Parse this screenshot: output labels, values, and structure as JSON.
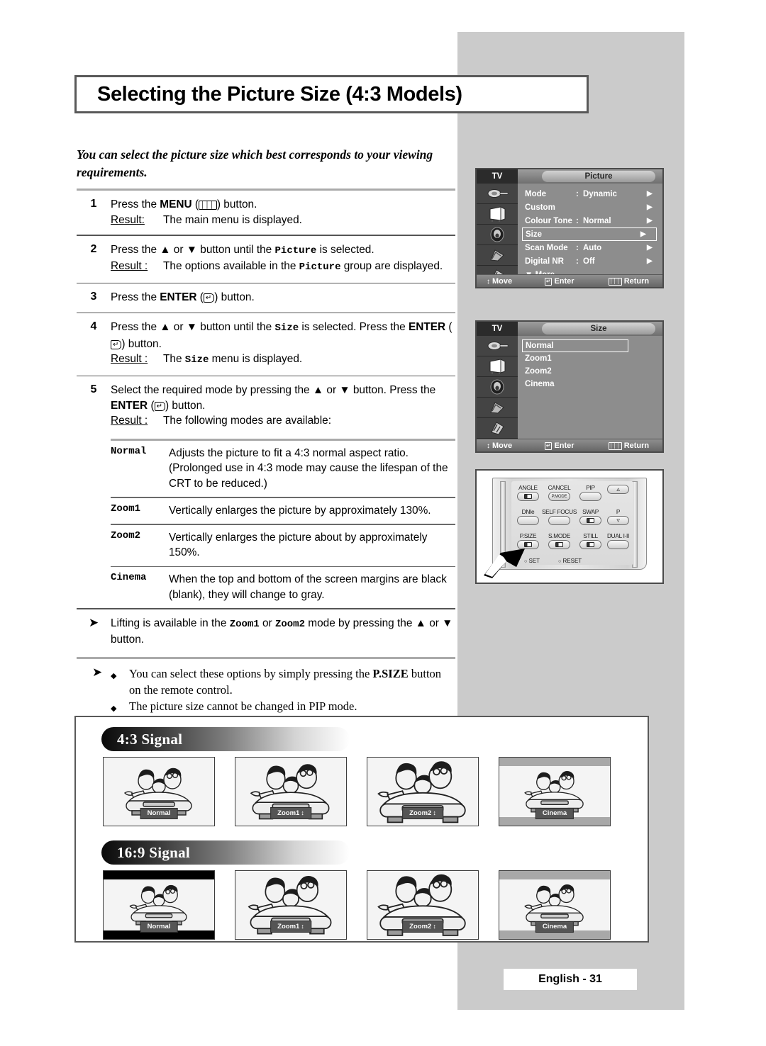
{
  "page": {
    "title": "Selecting the Picture Size (4:3 Models)",
    "intro": "You can select the picture size which best corresponds to your viewing requirements.",
    "footer": "English - 31"
  },
  "steps": [
    {
      "num": "1",
      "line1_a": "Press the ",
      "line1_bold": "MENU",
      "line1_b": " (",
      "key": "menu-icon",
      "line1_c": ") button.",
      "result_label": "Result:",
      "result_text": "The main menu is displayed."
    },
    {
      "num": "2",
      "line1_a": "Press the ▲ or ▼ button until the ",
      "mono1": "Picture",
      "line1_b": " is selected.",
      "result_label": "Result :",
      "result_a": "The options available in the ",
      "result_mono": "Picture",
      "result_b": " group are displayed."
    },
    {
      "num": "3",
      "line1_a": "Press the ",
      "line1_bold": "ENTER",
      "line1_b": " (",
      "key": "enter-icon",
      "line1_c": ") button."
    },
    {
      "num": "4",
      "line1_a": "Press the ▲ or ▼ button until the ",
      "mono1": "Size",
      "line1_b": " is selected. Press the ",
      "line2_bold": "ENTER",
      "line2_b": " (",
      "line2_c": ") button.",
      "result_label": "Result :",
      "result_a": "The ",
      "result_mono": "Size",
      "result_b": " menu is displayed."
    },
    {
      "num": "5",
      "line1_a": "Select the required  mode by pressing the ▲ or ▼ button. Press the ",
      "line2_bold": "ENTER",
      "line2_b": " (",
      "line2_c": ") button.",
      "result_label": "Result :",
      "result_text": "The following modes are available:"
    }
  ],
  "modes": [
    {
      "name": "Normal",
      "desc": "Adjusts the picture to fit a 4:3 normal aspect ratio. (Prolonged use in 4:3 mode may cause the lifespan of the CRT to be reduced.)"
    },
    {
      "name": "Zoom1",
      "desc": "Vertically enlarges the picture by approximately 130%."
    },
    {
      "name": "Zoom2",
      "desc": "Vertically enlarges the picture about by approximately 150%."
    },
    {
      "name": "Cinema",
      "desc": "When the top and bottom of the screen margins are black (blank), they will change to gray."
    }
  ],
  "notes": {
    "note1_a": "Lifting is available in the ",
    "note1_mono1": "Zoom1",
    "note1_b": " or ",
    "note1_mono2": "Zoom2",
    "note1_c": " mode by pressing the ▲ or ▼ button.",
    "note2_a": "You can select these options by simply pressing the ",
    "note2_bold": "P.SIZE",
    "note2_b": " button on the remote control.",
    "note3": "The picture size cannot be changed in PIP mode."
  },
  "osd_picture": {
    "tv_label": "TV",
    "tab_label": "Picture",
    "rows": [
      {
        "label": "Mode",
        "colon": ":",
        "value": "Dynamic",
        "arrow": "▶",
        "selected": false
      },
      {
        "label": "Custom",
        "colon": "",
        "value": "",
        "arrow": "▶",
        "selected": false
      },
      {
        "label": "Colour Tone",
        "colon": ":",
        "value": "Normal",
        "arrow": "▶",
        "selected": false
      },
      {
        "label": "Size",
        "colon": "",
        "value": "",
        "arrow": "▶",
        "selected": true
      },
      {
        "label": "Scan Mode",
        "colon": ":",
        "value": "Auto",
        "arrow": "▶",
        "selected": false
      },
      {
        "label": "Digital NR",
        "colon": ":",
        "value": "Off",
        "arrow": "▶",
        "selected": false
      }
    ],
    "more": "▼ More",
    "footer": {
      "move": "Move",
      "enter": "Enter",
      "return": "Return"
    }
  },
  "osd_size": {
    "tv_label": "TV",
    "tab_label": "Size",
    "options": [
      {
        "label": "Normal",
        "selected": true
      },
      {
        "label": "Zoom1",
        "selected": false
      },
      {
        "label": "Zoom2",
        "selected": false
      },
      {
        "label": "Cinema",
        "selected": false
      }
    ],
    "footer": {
      "move": "Move",
      "enter": "Enter",
      "return": "Return"
    }
  },
  "remote": {
    "buttons": [
      {
        "label": "ANGLE",
        "glyph": "icon"
      },
      {
        "label": "CANCEL",
        "glyph": "P.MODE"
      },
      {
        "label": "PIP",
        "glyph": ""
      },
      {
        "label": "",
        "glyph": "⌃"
      },
      {
        "label": "DNIe",
        "glyph": ""
      },
      {
        "label": "SELF FOCUS",
        "glyph": ""
      },
      {
        "label": "SWAP",
        "glyph": "icon"
      },
      {
        "label": "P",
        "glyph": "⌄"
      },
      {
        "label": "P.SIZE",
        "glyph": "icon"
      },
      {
        "label": "S.MODE",
        "glyph": "icon"
      },
      {
        "label": "STILL",
        "glyph": "icon"
      },
      {
        "label": "DUAL I-II",
        "glyph": ""
      }
    ],
    "set_label": "SET",
    "reset_label": "RESET"
  },
  "signal_sections": [
    {
      "banner": "4:3 Signal",
      "shots": [
        {
          "label": "Normal",
          "stepper": false,
          "bars": "none"
        },
        {
          "label": "Zoom1",
          "stepper": true,
          "bars": "none"
        },
        {
          "label": "Zoom2",
          "stepper": true,
          "bars": "none"
        },
        {
          "label": "Cinema",
          "stepper": false,
          "bars": "gray"
        }
      ]
    },
    {
      "banner": "16:9 Signal",
      "shots": [
        {
          "label": "Normal",
          "stepper": false,
          "bars": "black"
        },
        {
          "label": "Zoom1",
          "stepper": true,
          "bars": "none"
        },
        {
          "label": "Zoom2",
          "stepper": true,
          "bars": "none"
        },
        {
          "label": "Cinema",
          "stepper": false,
          "bars": "gray"
        }
      ]
    }
  ]
}
